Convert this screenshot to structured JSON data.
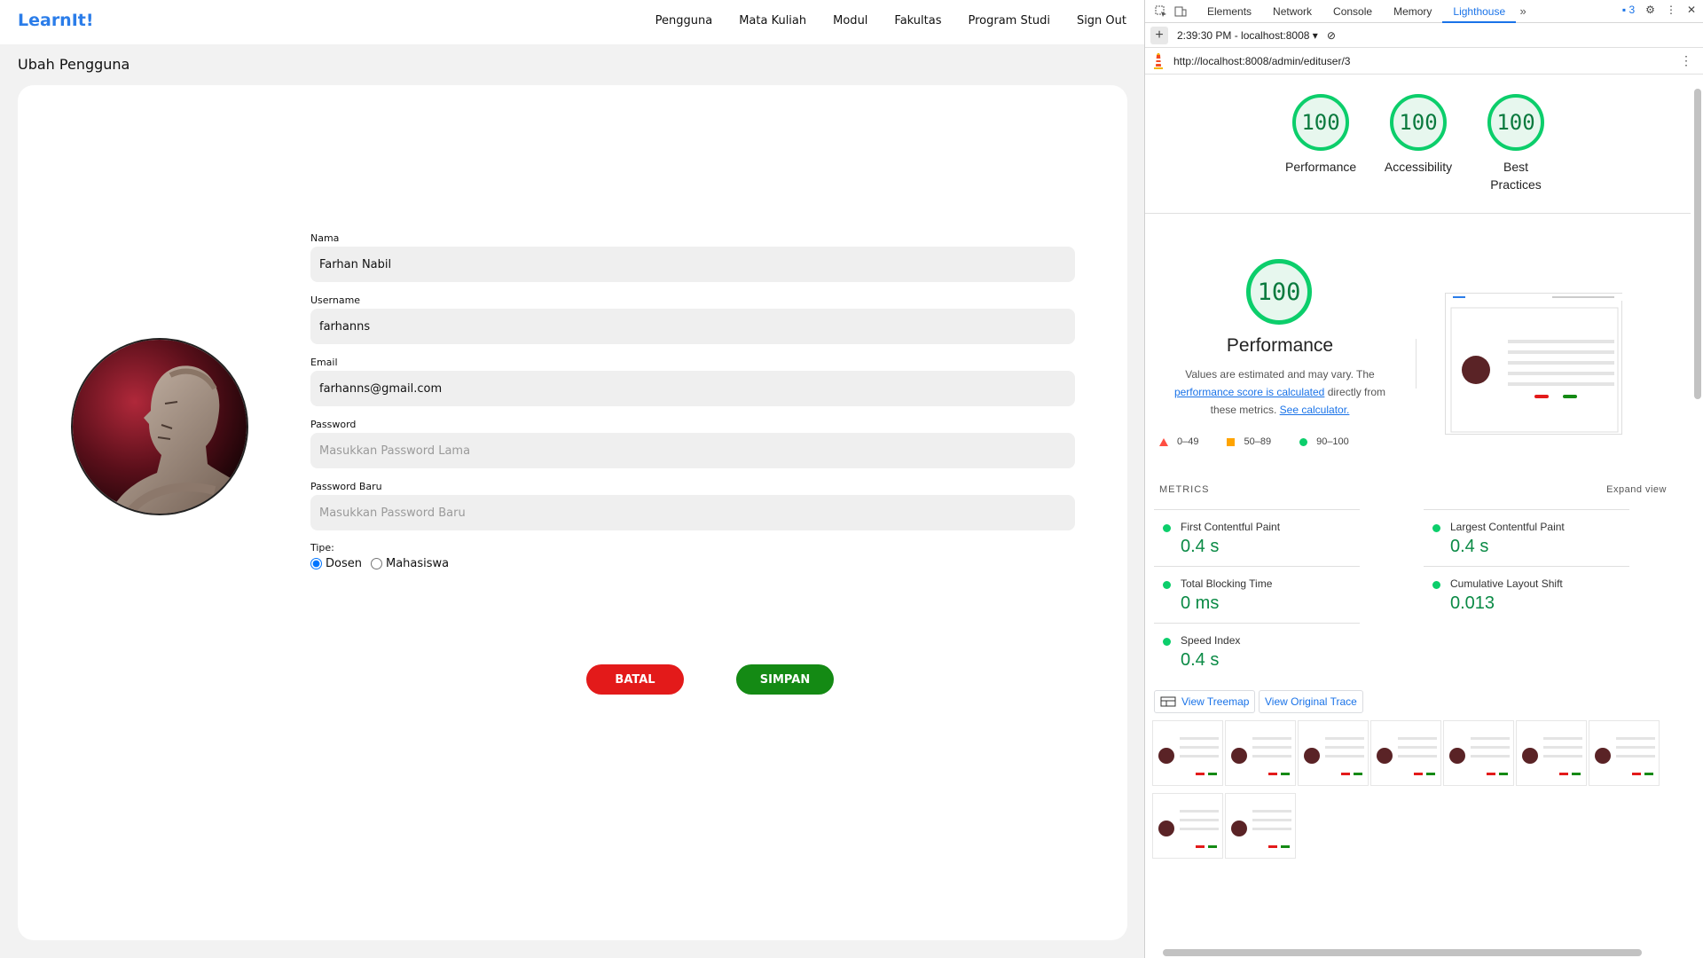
{
  "app": {
    "logo": "LearnIt!",
    "nav": [
      "Pengguna",
      "Mata Kuliah",
      "Modul",
      "Fakultas",
      "Program Studi",
      "Sign Out"
    ],
    "page_title": "Ubah Pengguna",
    "form": {
      "nama_label": "Nama",
      "nama_value": "Farhan Nabil",
      "username_label": "Username",
      "username_value": "farhanns",
      "email_label": "Email",
      "email_value": "farhanns@gmail.com",
      "password_label": "Password",
      "password_placeholder": "Masukkan Password Lama",
      "password_baru_label": "Password Baru",
      "password_baru_placeholder": "Masukkan Password Baru",
      "tipe_label": "Tipe:",
      "tipe_options": [
        "Dosen",
        "Mahasiswa"
      ],
      "tipe_selected": "Dosen",
      "batal_label": "BATAL",
      "simpan_label": "SIMPAN"
    }
  },
  "devtools": {
    "tabs": [
      "Elements",
      "Network",
      "Console",
      "Memory",
      "Lighthouse"
    ],
    "active_tab": "Lighthouse",
    "more_tabs": "»",
    "issues_count": "3",
    "report_time": "2:39:30 PM - localhost:8008",
    "url": "http://localhost:8008/admin/edituser/3",
    "scores": [
      {
        "label": "Performance",
        "value": "100"
      },
      {
        "label": "Accessibility",
        "value": "100"
      },
      {
        "label": "Best Practices",
        "value": "100"
      }
    ],
    "performance": {
      "score": "100",
      "title": "Performance",
      "desc_pre": "Values are estimated and may vary. The",
      "link1": "performance score is calculated",
      "desc_mid": "directly from these metrics.",
      "link2": "See calculator.",
      "legend": [
        "0–49",
        "50–89",
        "90–100"
      ]
    },
    "metrics_title": "METRICS",
    "expand_label": "Expand view",
    "metrics": [
      {
        "name": "First Contentful Paint",
        "value": "0.4 s"
      },
      {
        "name": "Largest Contentful Paint",
        "value": "0.4 s"
      },
      {
        "name": "Total Blocking Time",
        "value": "0 ms"
      },
      {
        "name": "Cumulative Layout Shift",
        "value": "0.013"
      },
      {
        "name": "Speed Index",
        "value": "0.4 s"
      }
    ],
    "treemap_label": "View Treemap",
    "trace_label": "View Original Trace",
    "score_color": "#0cce6b"
  }
}
